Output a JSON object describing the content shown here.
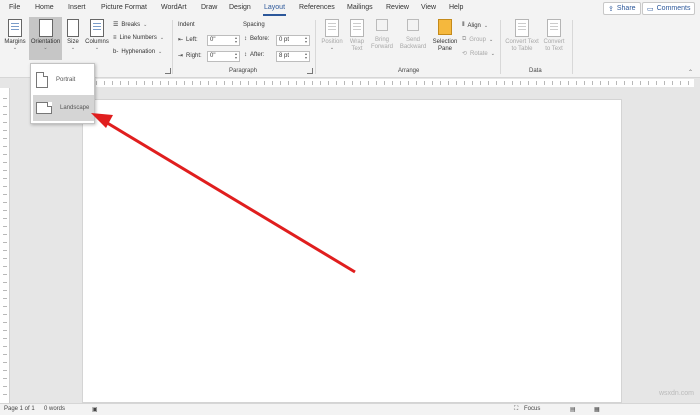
{
  "tabs": [
    "File",
    "Home",
    "Insert",
    "Picture Format",
    "WordArt",
    "Draw",
    "Design",
    "Layout",
    "References",
    "Mailings",
    "Review",
    "View",
    "Help"
  ],
  "active_tab": "Layout",
  "top_buttons": {
    "share": "Share",
    "comments": "Comments"
  },
  "page_setup": {
    "margins": "Margins",
    "orientation": "Orientation",
    "size": "Size",
    "columns": "Columns",
    "breaks": "Breaks",
    "line_numbers": "Line Numbers",
    "hyphenation": "Hyphenation"
  },
  "paragraph": {
    "indent_title": "Indent",
    "spacing_title": "Spacing",
    "left_label": "Left:",
    "left_value": "0\"",
    "right_label": "Right:",
    "right_value": "0\"",
    "before_label": "Before:",
    "before_value": "0 pt",
    "after_label": "After:",
    "after_value": "8 pt",
    "group_label": "Paragraph"
  },
  "arrange": {
    "position": "Position",
    "wrap_text": "Wrap Text",
    "bring_forward": "Bring Forward",
    "send_backward": "Send Backward",
    "selection_pane": "Selection Pane",
    "align": "Align",
    "group": "Group",
    "rotate": "Rotate",
    "group_label": "Arrange"
  },
  "data_group": {
    "convert_text_to_table": "Convert Text to Table",
    "convert_to_text": "Convert to Text",
    "group_label": "Data"
  },
  "orientation_menu": {
    "portrait": "Portrait",
    "landscape": "Landscape"
  },
  "status": {
    "page": "Page 1 of 1",
    "words": "0 words",
    "focus": "Focus"
  },
  "watermark": "wsxdn.com",
  "colors": {
    "accent": "#2b579a",
    "arrow": "#e01e1e"
  }
}
